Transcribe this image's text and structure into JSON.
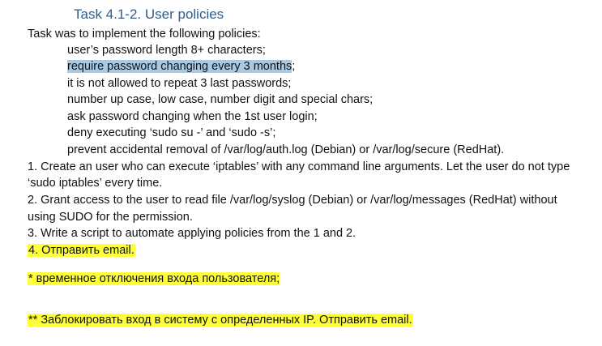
{
  "document": {
    "heading": "Task 4.1-2. User policies",
    "intro": "Task was to implement the following policies:",
    "policies": [
      "user’s password length 8+ characters;",
      "require password changing every 3 months",
      "it is not allowed to repeat 3 last passwords;",
      "number up case, low case, number digit and special chars;",
      "ask password changing when the 1st user login;",
      "deny executing ‘sudo su -’ and ‘sudo -s’;",
      "prevent accidental removal of /var/log/auth.log (Debian) or /var/log/secure (RedHat)."
    ],
    "policy_1_suffix": ";",
    "item1_line1": "1. Create an user who can execute ‘iptables’ with any command line arguments. Let the user do not type",
    "item1_line2": "‘sudo iptables’ every time.",
    "item2_line1": "2.  Grant access to the user to read file /var/log/syslog (Debian) or /var/log/messages (RedHat) without",
    "item2_line2": "using SUDO for the permission.",
    "item3": "3. Write a script to automate applying policies from the 1 and 2.",
    "item4": "4. Отправить email.",
    "note1": "* временное отключения входа пользователя;",
    "note2": "** Заблокировать вход в систему с определенных IP. Отправить email."
  },
  "colors": {
    "heading": "#2f5c8a",
    "selection_highlight": "#a9c9e3",
    "yellow_highlight": "#ffff3a",
    "text": "#111111"
  }
}
